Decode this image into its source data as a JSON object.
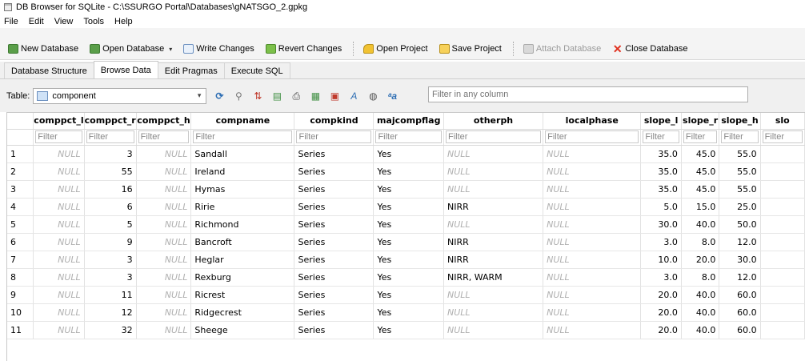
{
  "window": {
    "title": "DB Browser for SQLite - C:\\SSURGO Portal\\Databases\\gNATSGO_2.gpkg"
  },
  "menu": [
    "File",
    "Edit",
    "View",
    "Tools",
    "Help"
  ],
  "toolbar": {
    "new_database": "New Database",
    "open_database": "Open Database",
    "write_changes": "Write Changes",
    "revert_changes": "Revert Changes",
    "open_project": "Open Project",
    "save_project": "Save Project",
    "attach_database": "Attach Database",
    "close_database": "Close Database"
  },
  "tabs": [
    "Database Structure",
    "Browse Data",
    "Edit Pragmas",
    "Execute SQL"
  ],
  "active_tab": "Browse Data",
  "browse": {
    "table_label": "Table:",
    "table_selected": "component",
    "filter_placeholder": "Filter in any column"
  },
  "grid": {
    "columns": [
      "comppct_l",
      "comppct_r",
      "comppct_h",
      "compname",
      "compkind",
      "majcompflag",
      "otherph",
      "localphase",
      "slope_l",
      "slope_r",
      "slope_h",
      "slo"
    ],
    "filter_placeholder": "Filter",
    "null_text": "NULL",
    "rows": [
      [
        "1",
        "NULL",
        "3",
        "NULL",
        "Sandall",
        "Series",
        "Yes",
        "NULL",
        "NULL",
        "35.0",
        "45.0",
        "55.0"
      ],
      [
        "2",
        "NULL",
        "55",
        "NULL",
        "Ireland",
        "Series",
        "Yes",
        "NULL",
        "NULL",
        "35.0",
        "45.0",
        "55.0"
      ],
      [
        "3",
        "NULL",
        "16",
        "NULL",
        "Hymas",
        "Series",
        "Yes",
        "NULL",
        "NULL",
        "35.0",
        "45.0",
        "55.0"
      ],
      [
        "4",
        "NULL",
        "6",
        "NULL",
        "Ririe",
        "Series",
        "Yes",
        "NIRR",
        "NULL",
        "5.0",
        "15.0",
        "25.0"
      ],
      [
        "5",
        "NULL",
        "5",
        "NULL",
        "Richmond",
        "Series",
        "Yes",
        "NULL",
        "NULL",
        "30.0",
        "40.0",
        "50.0"
      ],
      [
        "6",
        "NULL",
        "9",
        "NULL",
        "Bancroft",
        "Series",
        "Yes",
        "NIRR",
        "NULL",
        "3.0",
        "8.0",
        "12.0"
      ],
      [
        "7",
        "NULL",
        "3",
        "NULL",
        "Heglar",
        "Series",
        "Yes",
        "NIRR",
        "NULL",
        "10.0",
        "20.0",
        "30.0"
      ],
      [
        "8",
        "NULL",
        "3",
        "NULL",
        "Rexburg",
        "Series",
        "Yes",
        "NIRR, WARM",
        "NULL",
        "3.0",
        "8.0",
        "12.0"
      ],
      [
        "9",
        "NULL",
        "11",
        "NULL",
        "Ricrest",
        "Series",
        "Yes",
        "NULL",
        "NULL",
        "20.0",
        "40.0",
        "60.0"
      ],
      [
        "10",
        "NULL",
        "12",
        "NULL",
        "Ridgecrest",
        "Series",
        "Yes",
        "NULL",
        "NULL",
        "20.0",
        "40.0",
        "60.0"
      ],
      [
        "11",
        "NULL",
        "32",
        "NULL",
        "Sheege",
        "Series",
        "Yes",
        "NULL",
        "NULL",
        "20.0",
        "40.0",
        "60.0"
      ]
    ]
  },
  "colors": {
    "accent": "#2f6fb4",
    "close_red": "#e0311f",
    "null_gray": "#b0b0b0"
  }
}
